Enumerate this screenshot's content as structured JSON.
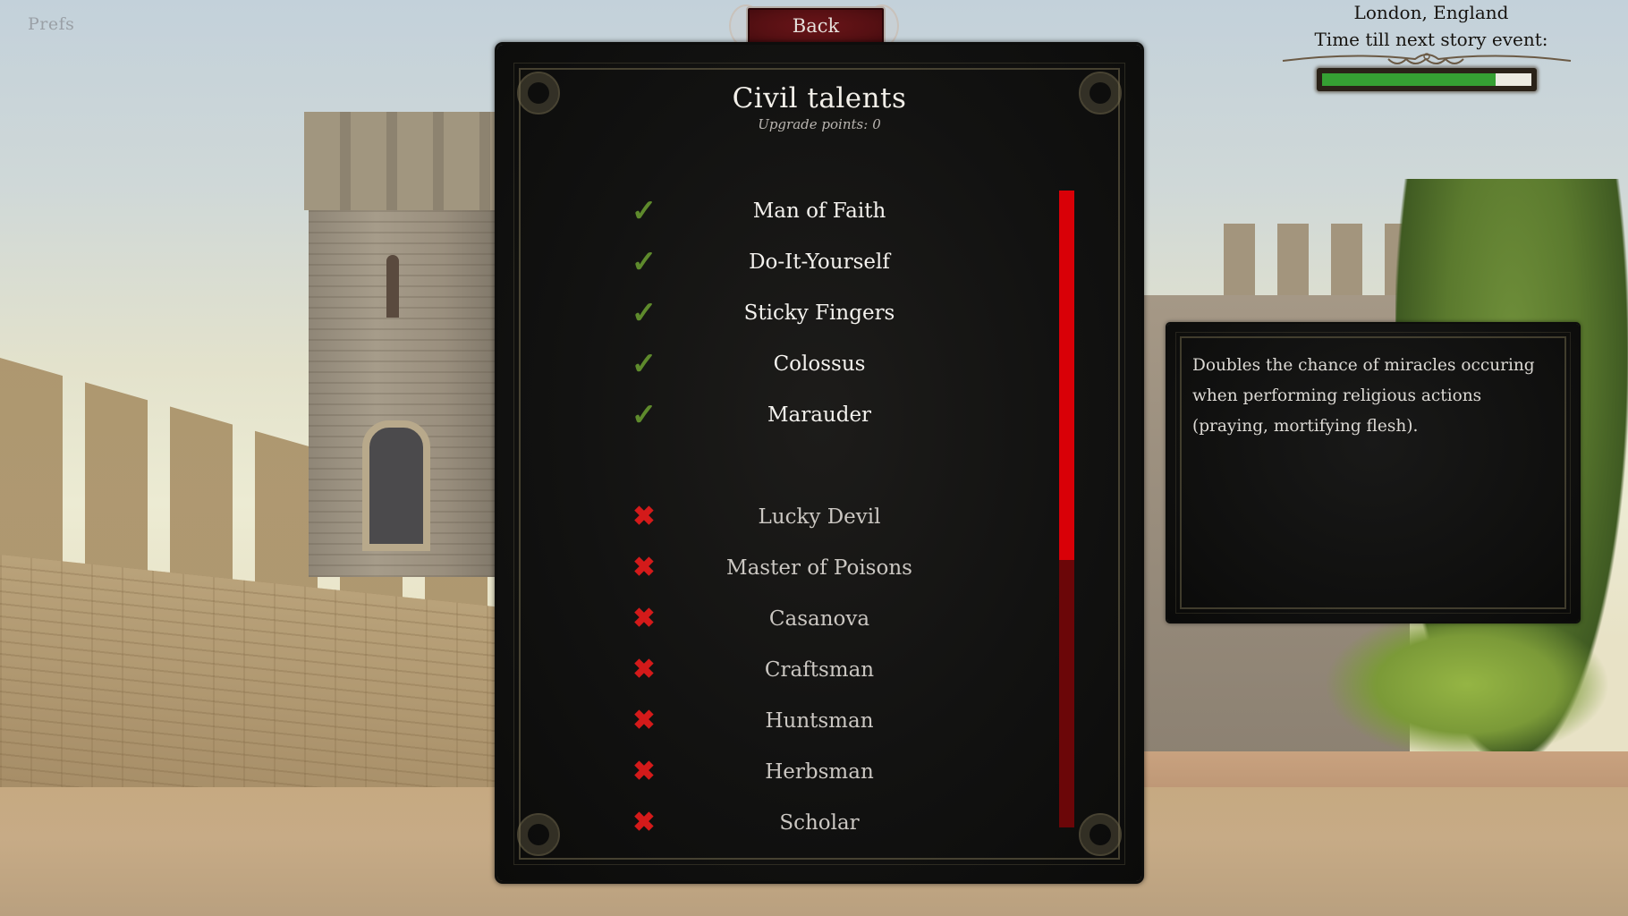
{
  "topbar": {
    "prefs_label": "Prefs",
    "back_label": "Back"
  },
  "panel": {
    "title": "Civil talents",
    "upgrade_points_label": "Upgrade points:",
    "upgrade_points_value": "0"
  },
  "talents": [
    {
      "name": "Man of Faith",
      "status": "owned",
      "icon": "check-icon"
    },
    {
      "name": "Do-It-Yourself",
      "status": "owned",
      "icon": "check-icon"
    },
    {
      "name": "Sticky Fingers",
      "status": "owned",
      "icon": "check-icon"
    },
    {
      "name": "Colossus",
      "status": "owned",
      "icon": "check-icon"
    },
    {
      "name": "Marauder",
      "status": "owned",
      "icon": "check-icon"
    },
    {
      "name": "Lucky Devil",
      "status": "locked",
      "icon": "cross-icon"
    },
    {
      "name": "Master of Poisons",
      "status": "locked",
      "icon": "cross-icon"
    },
    {
      "name": "Casanova",
      "status": "locked",
      "icon": "cross-icon"
    },
    {
      "name": "Craftsman",
      "status": "locked",
      "icon": "cross-icon"
    },
    {
      "name": "Huntsman",
      "status": "locked",
      "icon": "cross-icon"
    },
    {
      "name": "Herbsman",
      "status": "locked",
      "icon": "cross-icon"
    },
    {
      "name": "Scholar",
      "status": "locked",
      "icon": "cross-icon"
    }
  ],
  "scrollbar": {
    "visible_fraction": 0.58,
    "scroll_position": 0
  },
  "description": {
    "text": "Doubles the chance of miracles occuring when performing religious actions (praying, mortifying flesh)."
  },
  "location": {
    "name": "London, England",
    "story_label": "Time till next story event:",
    "story_progress": 0.83
  },
  "colors": {
    "owned_icon": "#5e8a2c",
    "locked_icon": "#d41a1a",
    "scroll_thumb": "#d90007",
    "scroll_track": "#6b0608",
    "progress_fill": "#35a033",
    "back_button": "#5a1014"
  }
}
